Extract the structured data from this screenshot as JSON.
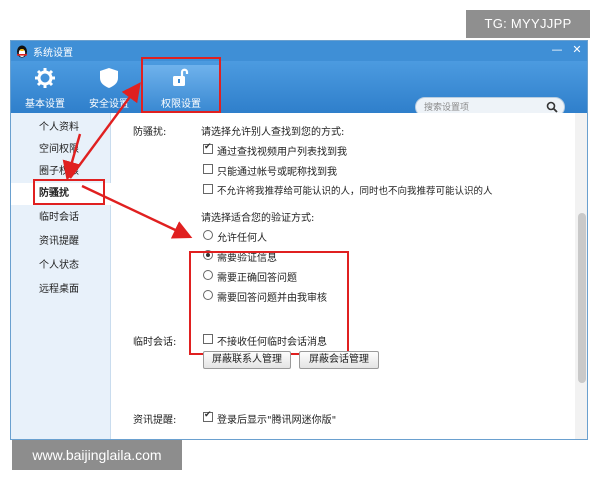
{
  "watermarks": {
    "top": "TG: MYYJJPP",
    "bottom": "www.baijinglaila.com"
  },
  "window": {
    "title": "系统设置",
    "controls": [
      "—",
      "✕"
    ]
  },
  "toolbar": {
    "basic_label": "基本设置",
    "security_label": "安全设置",
    "permission_label": "权限设置"
  },
  "search": {
    "placeholder": "搜索设置项"
  },
  "sidebar": {
    "items": [
      {
        "label": "个人资料"
      },
      {
        "label": "空间权限"
      },
      {
        "label": "圈子权限"
      },
      {
        "label": "防骚扰"
      },
      {
        "label": "临时会话"
      },
      {
        "label": "资讯提醒"
      },
      {
        "label": "个人状态"
      },
      {
        "label": "远程桌面"
      }
    ],
    "active_index": 3
  },
  "content": {
    "anti_harass": {
      "label": "防骚扰:",
      "find_title": "请选择允许别人查找到您的方式:",
      "find_options": [
        {
          "text": "通过查找视频用户列表找到我",
          "checked": true
        },
        {
          "text": "只能通过帐号或昵称找到我",
          "checked": false
        },
        {
          "text": "不允许将我推荐给可能认识的人，同时也不向我推荐可能认识的人",
          "checked": false
        }
      ],
      "verify_title": "请选择适合您的验证方式:",
      "verify_options": [
        {
          "text": "允许任何人",
          "selected": false
        },
        {
          "text": "需要验证信息",
          "selected": true
        },
        {
          "text": "需要正确回答问题",
          "selected": false
        },
        {
          "text": "需要回答问题并由我审核",
          "selected": false
        }
      ]
    },
    "temp_chat": {
      "label": "临时会话:",
      "option": {
        "text": "不接收任何临时会话消息",
        "checked": false
      },
      "buttons": [
        "屏蔽联系人管理",
        "屏蔽会话管理"
      ]
    },
    "news": {
      "label": "资讯提醒:",
      "option": {
        "text": "登录后显示\"腾讯网迷你版\"",
        "checked": true
      }
    }
  },
  "colors": {
    "title_bar": "#3f8fd6",
    "highlight_red": "#e02020",
    "sidebar_bg": "#e8f1fa"
  }
}
